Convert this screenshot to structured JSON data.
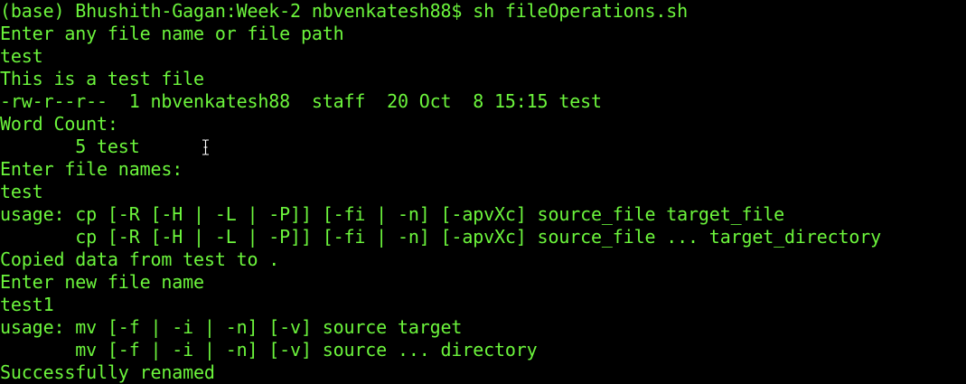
{
  "terminal": {
    "text_color": "#6cf53c",
    "background_color": "#000000",
    "lines": [
      "(base) Bhushith-Gagan:Week-2 nbvenkatesh88$ sh fileOperations.sh",
      "Enter any file name or file path",
      "test",
      "This is a test file",
      "-rw-r--r--  1 nbvenkatesh88  staff  20 Oct  8 15:15 test",
      "Word Count:",
      "       5 test",
      "Enter file names:",
      "test",
      "usage: cp [-R [-H | -L | -P]] [-fi | -n] [-apvXc] source_file target_file",
      "       cp [-R [-H | -L | -P]] [-fi | -n] [-apvXc] source_file ... target_directory",
      "Copied data from test to .",
      "Enter new file name",
      "test1",
      "usage: mv [-f | -i | -n] [-v] source target",
      "       mv [-f | -i | -n] [-v] source ... directory",
      "Successfully renamed"
    ],
    "mouse_cursor_icon": "ibeam-cursor-icon"
  }
}
